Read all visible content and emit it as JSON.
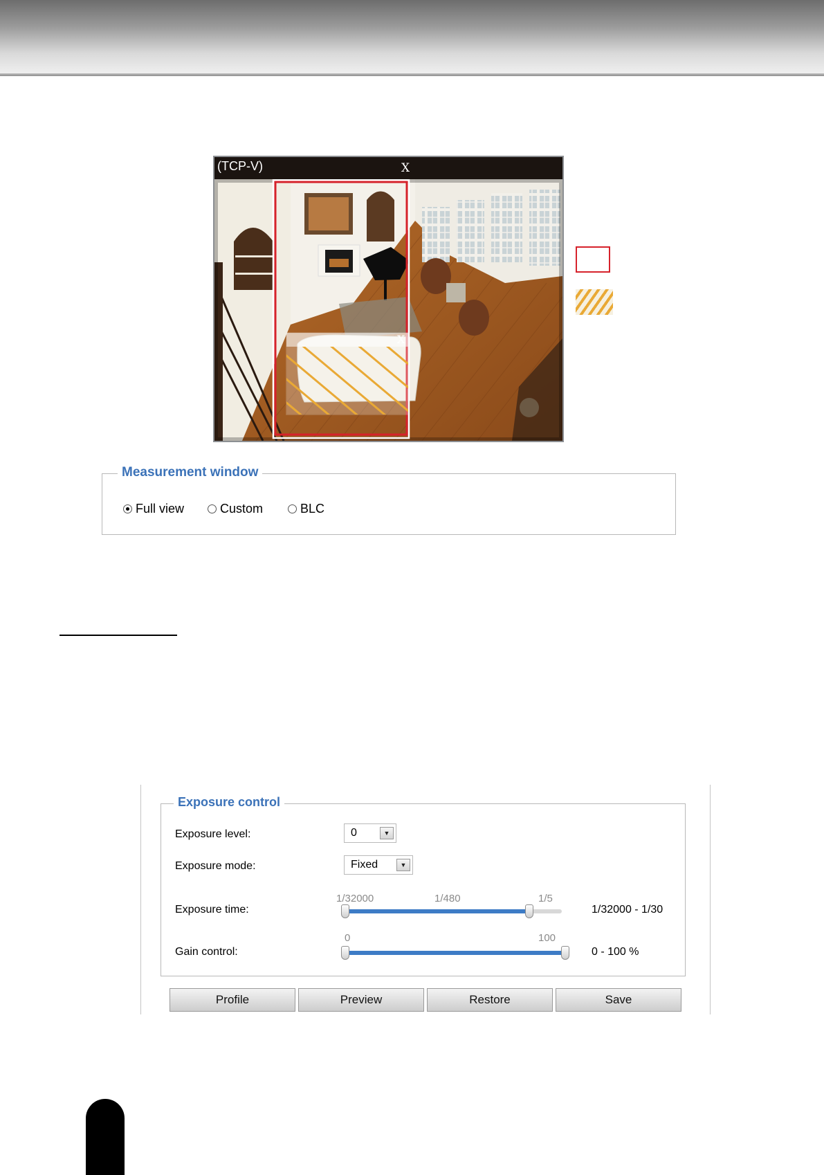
{
  "camera": {
    "title": "(TCP-V)",
    "close_glyph": "X"
  },
  "measurement_window": {
    "legend": "Measurement window",
    "options": [
      {
        "label": "Full view",
        "checked": true
      },
      {
        "label": "Custom",
        "checked": false
      },
      {
        "label": "BLC",
        "checked": false
      }
    ]
  },
  "exposure_control": {
    "legend": "Exposure control",
    "exposure_level": {
      "label": "Exposure level:",
      "value": "0"
    },
    "exposure_mode": {
      "label": "Exposure mode:",
      "value": "Fixed"
    },
    "exposure_time": {
      "label": "Exposure time:",
      "ticks": [
        "1/32000",
        "1/480",
        "1/5"
      ],
      "range": "1/32000 - 1/30",
      "level": 0.85
    },
    "gain_control": {
      "label": "Gain control:",
      "ticks": [
        "0",
        "100"
      ],
      "range": "0 - 100 %",
      "level": 1.0
    },
    "buttons": {
      "profile": "Profile",
      "preview": "Preview",
      "restore": "Restore",
      "save": "Save"
    }
  },
  "colors": {
    "accent_blue": "#3b72b8",
    "slider_fill": "#3d7cc6",
    "custom_window": "#d6222b",
    "blc_hatch": "#e9a935"
  }
}
